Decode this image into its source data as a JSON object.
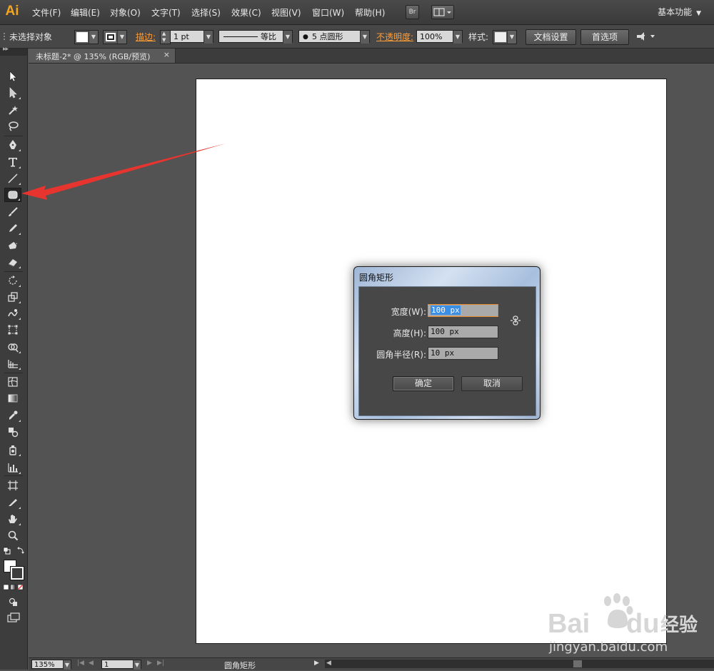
{
  "app": {
    "logo": "Ai"
  },
  "menu": [
    {
      "id": "file",
      "label": "文件(F)"
    },
    {
      "id": "edit",
      "label": "编辑(E)"
    },
    {
      "id": "object",
      "label": "对象(O)"
    },
    {
      "id": "type",
      "label": "文字(T)"
    },
    {
      "id": "select",
      "label": "选择(S)"
    },
    {
      "id": "effect",
      "label": "效果(C)"
    },
    {
      "id": "view",
      "label": "视图(V)"
    },
    {
      "id": "window",
      "label": "窗口(W)"
    },
    {
      "id": "help",
      "label": "帮助(H)"
    }
  ],
  "bridge_label": "Br",
  "workspace": "基本功能",
  "control": {
    "selection": "未选择对象",
    "stroke_label": "描边:",
    "stroke_weight": "1 pt",
    "stroke_profile": "等比",
    "brush": "5 点圆形",
    "opacity_label": "不透明度:",
    "opacity": "100%",
    "style_label": "样式:",
    "doc_setup": "文档设置",
    "preferences": "首选项"
  },
  "tab": {
    "title": "未标题-2* @ 135% (RGB/预览)",
    "close": "×"
  },
  "tools": [
    {
      "name": "selection-tool-icon"
    },
    {
      "name": "direct-selection-tool-icon"
    },
    {
      "name": "magic-wand-tool-icon"
    },
    {
      "name": "lasso-tool-icon"
    },
    {
      "name": "pen-tool-icon"
    },
    {
      "name": "type-tool-icon"
    },
    {
      "name": "line-segment-tool-icon"
    },
    {
      "name": "rounded-rectangle-tool-icon"
    },
    {
      "name": "paintbrush-tool-icon"
    },
    {
      "name": "pencil-tool-icon"
    },
    {
      "name": "blob-brush-tool-icon"
    },
    {
      "name": "eraser-tool-icon"
    },
    {
      "name": "rotate-tool-icon"
    },
    {
      "name": "scale-tool-icon"
    },
    {
      "name": "warp-tool-icon"
    },
    {
      "name": "free-transform-tool-icon"
    },
    {
      "name": "shape-builder-tool-icon"
    },
    {
      "name": "perspective-grid-tool-icon"
    },
    {
      "name": "mesh-tool-icon"
    },
    {
      "name": "gradient-tool-icon"
    },
    {
      "name": "eyedropper-tool-icon"
    },
    {
      "name": "blend-tool-icon"
    },
    {
      "name": "symbol-sprayer-tool-icon"
    },
    {
      "name": "column-graph-tool-icon"
    },
    {
      "name": "artboard-tool-icon"
    },
    {
      "name": "slice-tool-icon"
    },
    {
      "name": "hand-tool-icon"
    },
    {
      "name": "zoom-tool-icon"
    }
  ],
  "dialog": {
    "title": "圆角矩形",
    "width_label": "宽度(W):",
    "width_value": "100 px",
    "height_label": "高度(H):",
    "height_value": "100 px",
    "radius_label": "圆角半径(R):",
    "radius_value": "10 px",
    "ok": "确定",
    "cancel": "取消"
  },
  "status": {
    "zoom": "135%",
    "artboard_number": "1",
    "current_tool": "圆角矩形"
  },
  "watermark": {
    "brand": "Bai",
    "brand2": "du",
    "cn": "经验",
    "url": "jingyan.baidu.com"
  },
  "colors": {
    "accent_orange": "#ff9c36",
    "arrow_red": "#e8342f",
    "ui_bg": "#535353",
    "logo": "#f4a621"
  }
}
